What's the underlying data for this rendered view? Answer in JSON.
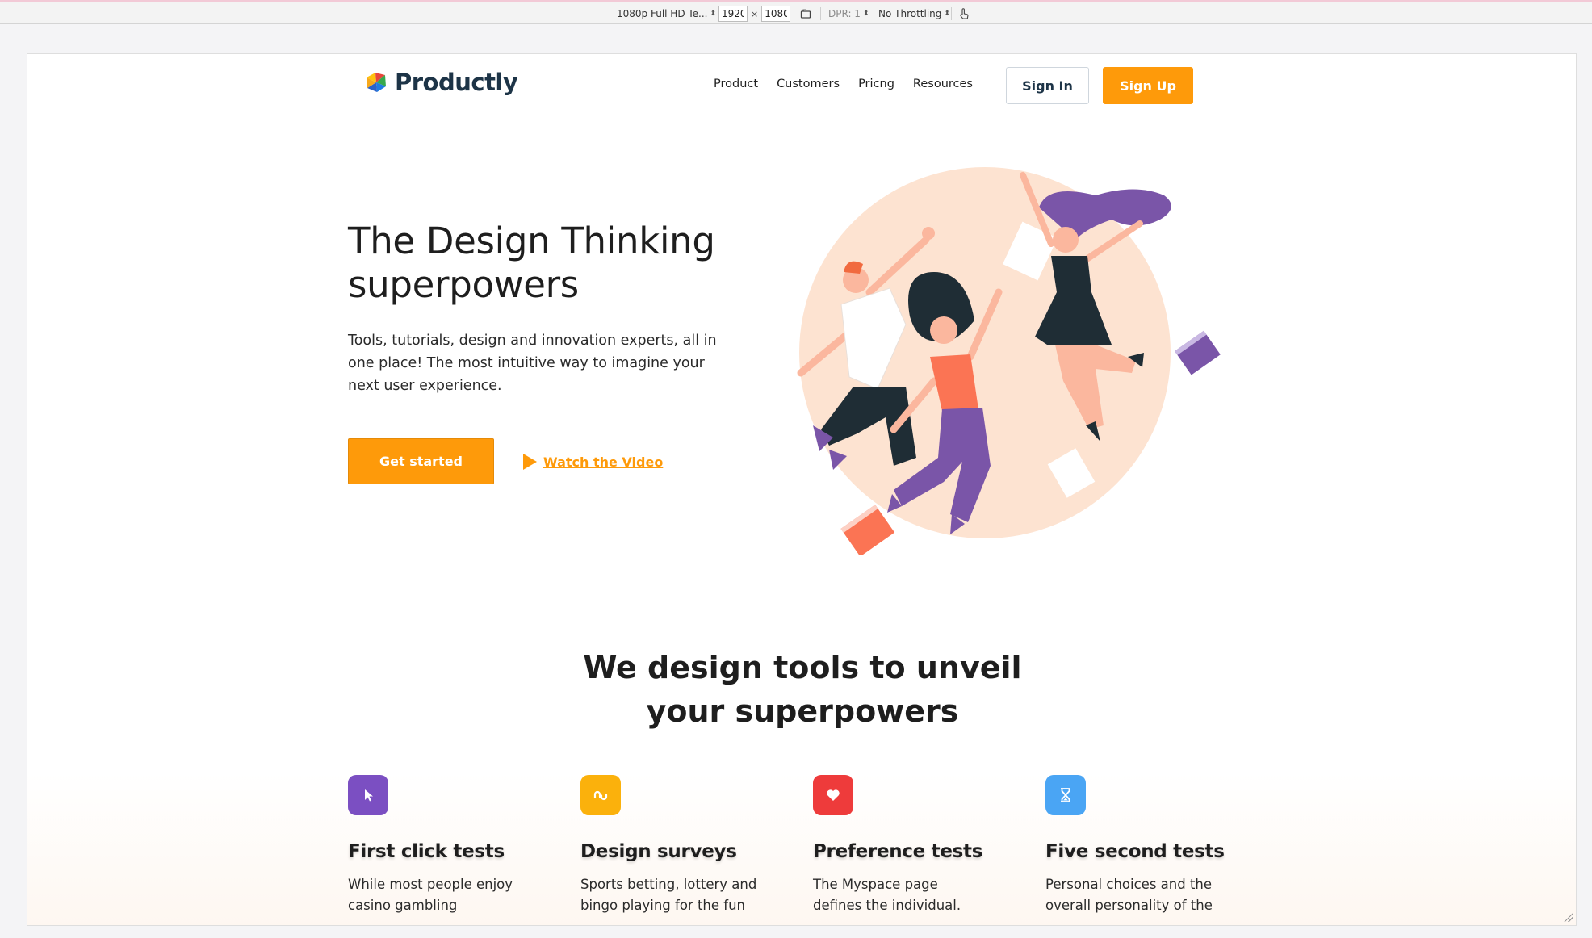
{
  "devtools": {
    "device": "1080p Full HD Te...",
    "width": "1920",
    "height": "1080",
    "times": "×",
    "dpr": "DPR: 1",
    "throttling": "No Throttling"
  },
  "header": {
    "brand": "Productly",
    "nav": [
      "Product",
      "Customers",
      "Pricng",
      "Resources"
    ],
    "sign_in": "Sign In",
    "sign_up": "Sign Up"
  },
  "hero": {
    "title_line1": "The Design Thinking",
    "title_line2": "superpowers",
    "subtitle": "Tools, tutorials, design and innovation experts, all in one place! The most intuitive way to imagine your next user experience.",
    "cta": "Get started",
    "watch": "Watch the Video"
  },
  "features_section": {
    "title_line1": "We design tools to unveil",
    "title_line2": "your superpowers",
    "items": [
      {
        "icon": "cursor-icon",
        "color": "#7b4fc2",
        "title": "First click tests",
        "text": "While most people enjoy casino gambling"
      },
      {
        "icon": "stumbleupon-icon",
        "color": "#fbb10c",
        "title": "Design surveys",
        "text": "Sports betting, lottery and bingo playing for the fun"
      },
      {
        "icon": "heart-icon",
        "color": "#ee3b3b",
        "title": "Preference tests",
        "text": "The Myspace page defines the individual."
      },
      {
        "icon": "hourglass-icon",
        "color": "#4aa5f4",
        "title": "Five second tests",
        "text": "Personal choices and the overall personality of the"
      }
    ]
  },
  "colors": {
    "accent": "#fe9a0a",
    "navy": "#1d3447"
  }
}
